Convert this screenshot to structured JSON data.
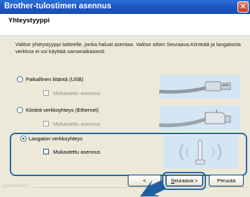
{
  "window": {
    "title": "Brother-tulostimen asennus",
    "close_label": "✕"
  },
  "header": {
    "title": "Yhteystyyppi"
  },
  "intro": {
    "text": "Valitse yhteystyyppi laitteelle, jonka haluat asentaa. Valitse sitten Seuraava.Kiinteää ja langatonta verkkoa ei voi käyttää samanaikaisesti."
  },
  "options": [
    {
      "label": "Paikallinen liitäntä (USB)",
      "selected": false,
      "custom_install_label": "Mukautettu asennus",
      "custom_install_enabled": false,
      "picture_icon": "usb-cable-icon"
    },
    {
      "label": "Kiinteä verkkoyhteys (Ethernet)",
      "selected": false,
      "custom_install_label": "Mukautettu asennus",
      "custom_install_enabled": false,
      "picture_icon": "ethernet-cable-icon"
    },
    {
      "label": "Langaton verkkoyhteys",
      "selected": true,
      "custom_install_label": "Mukautettu asennus",
      "custom_install_enabled": true,
      "picture_icon": "wireless-signal-icon"
    }
  ],
  "footer": {
    "brand_text": "InstallShield"
  },
  "buttons": {
    "back_label": "<",
    "next_label_prefix": "S",
    "next_label_rest": "euraava >",
    "cancel_label": "Peruuta"
  },
  "colors": {
    "titlebar": "#1f58c4",
    "dialog_bg": "#ece9d8",
    "highlight": "#1f6aa5",
    "picture_bg": "#d4e6f4"
  }
}
